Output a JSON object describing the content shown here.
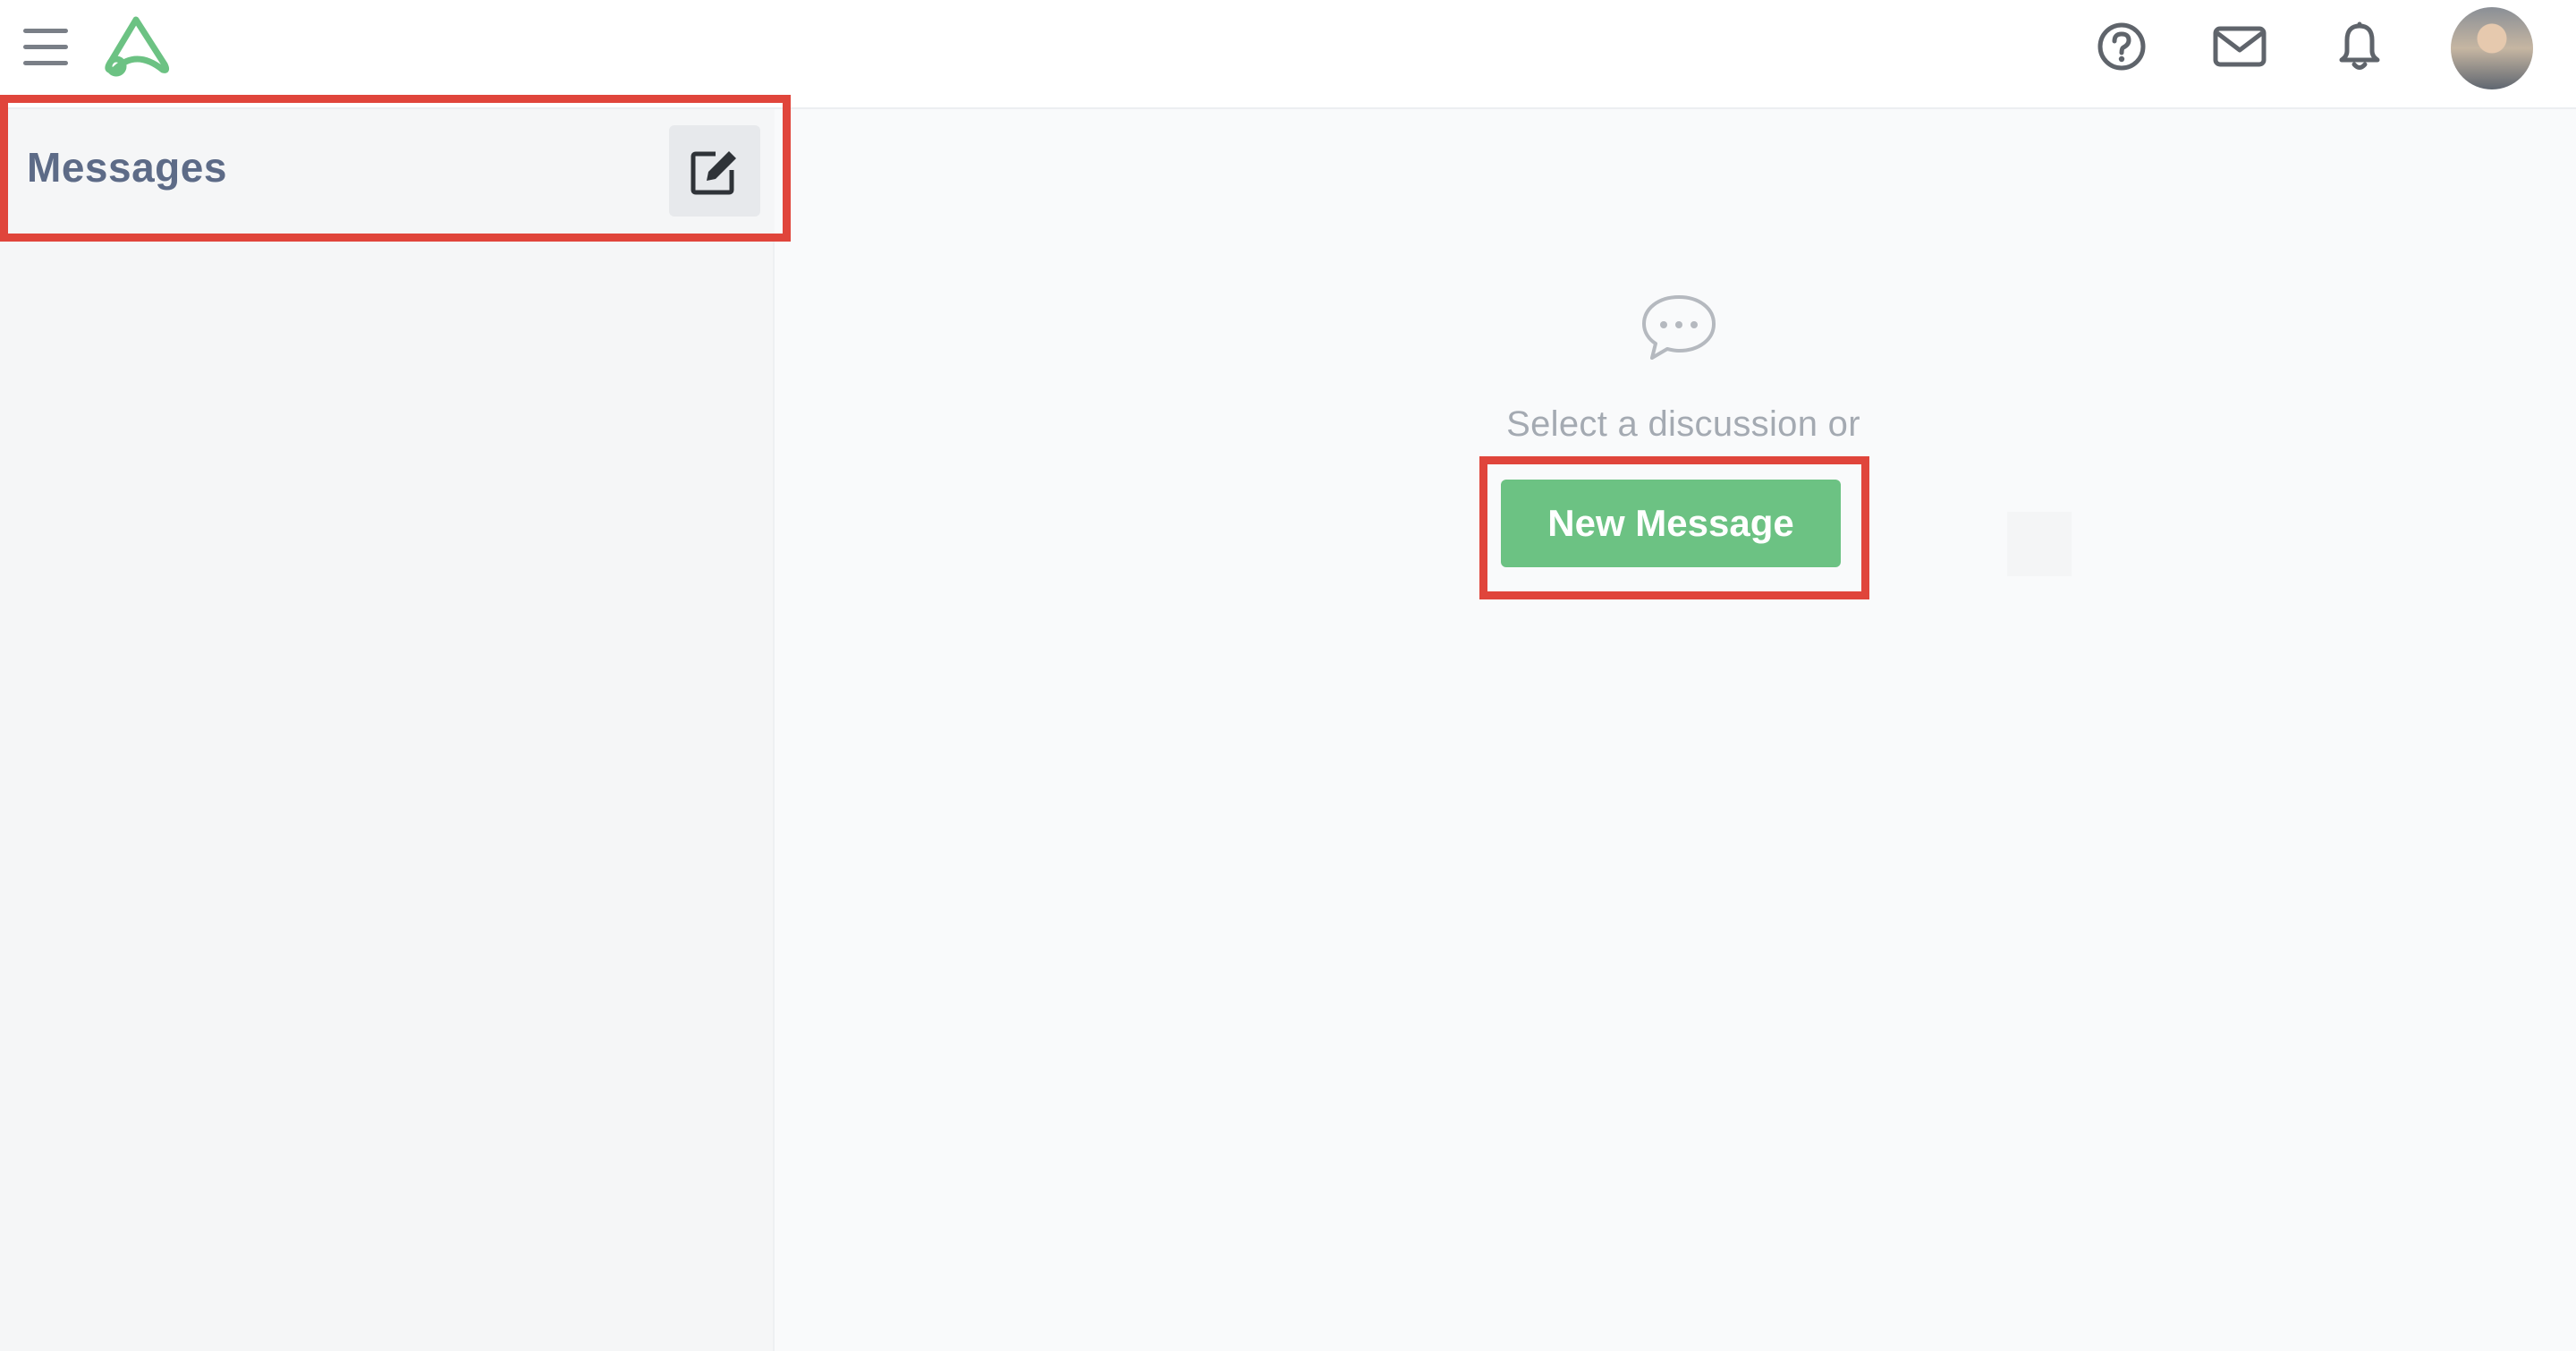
{
  "header": {
    "menu_icon": "hamburger-menu-icon",
    "logo_icon": "app-logo-icon",
    "help_icon": "question-circle-icon",
    "mail_icon": "envelope-icon",
    "notifications_icon": "bell-icon",
    "avatar_icon": "user-avatar"
  },
  "sidebar": {
    "title": "Messages",
    "compose_icon": "compose-edit-icon"
  },
  "main": {
    "empty_icon": "chat-bubble-icon",
    "empty_text": "Select a discussion or",
    "new_message_label": "New Message"
  },
  "colors": {
    "brand_green": "#6cc283",
    "highlight_red": "#e0453b",
    "title_slate": "#5d6b87"
  }
}
